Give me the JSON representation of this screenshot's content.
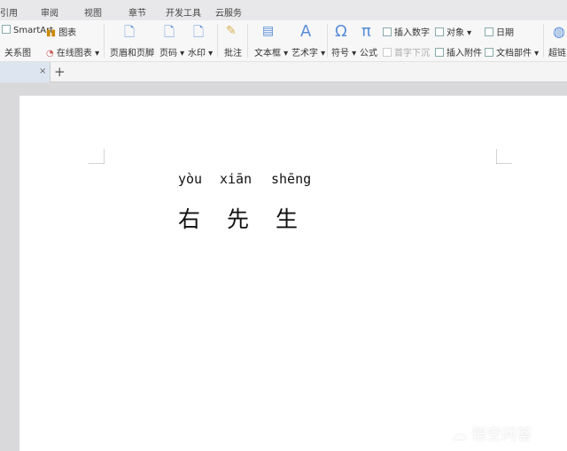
{
  "menu": [
    "引用",
    "审阅",
    "视图",
    "章节",
    "开发工具",
    "云服务"
  ],
  "ribbon": {
    "smartart": "SmartArt",
    "chart": "图表",
    "relation": "关系图",
    "online_chart": "在线图表",
    "header_footer": "页眉和页脚",
    "page_num": "页码",
    "watermark": "水印",
    "comment": "批注",
    "textbox": "文本框",
    "wordart": "艺术字",
    "symbol": "符号",
    "formula": "公式",
    "insert_number": "插入数字",
    "drop_cap": "首字下沉",
    "object": "对象",
    "attachment": "插入附件",
    "date": "日期",
    "doc_parts": "文档部件",
    "hyperlink": "超链"
  },
  "doc_tab": {
    "close": "×",
    "new": "+"
  },
  "document": {
    "pinyin": [
      "yòu",
      "xiān",
      "shēng"
    ],
    "chars": [
      "右",
      "先",
      "生"
    ]
  },
  "watermark": "悟空问答"
}
